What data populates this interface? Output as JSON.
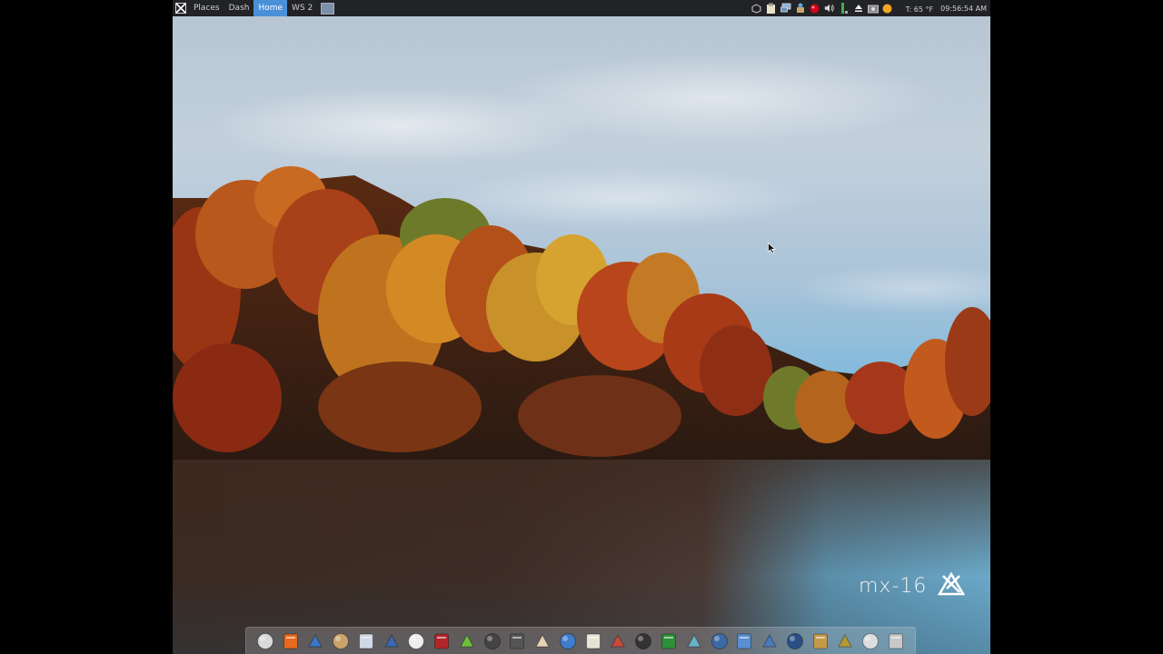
{
  "panel": {
    "tabs": [
      {
        "label": "Places"
      },
      {
        "label": "Dash"
      },
      {
        "label": "Home",
        "active": true
      },
      {
        "label": "WS 2"
      }
    ],
    "temperature": "T: 65 °F",
    "clock": "09:56:54 AM",
    "tray_icons": [
      "settings-cube-icon",
      "clipboard-icon",
      "network-icon",
      "package-updater-icon",
      "record-icon",
      "volume-icon",
      "battery-icon",
      "eject-icon",
      "screenshot-icon",
      "weather-sun-icon"
    ]
  },
  "desktop": {
    "brand": "mx-16",
    "brand_logo": "mx-logo-icon"
  },
  "dock": {
    "items": [
      {
        "name": "clock-app-icon",
        "color": "#d9d9d9"
      },
      {
        "name": "firefox-icon",
        "color": "#e66a1f"
      },
      {
        "name": "thunderbird-icon",
        "color": "#3b76c2"
      },
      {
        "name": "file-manager-icon",
        "color": "#c9a46a"
      },
      {
        "name": "text-editor-icon",
        "color": "#cfd8e6"
      },
      {
        "name": "calculator-icon",
        "color": "#3d66b0"
      },
      {
        "name": "dictionary-icon",
        "color": "#eeeeee"
      },
      {
        "name": "pdf-viewer-icon",
        "color": "#b2262a"
      },
      {
        "name": "leaf-app-icon",
        "color": "#6fbf3a"
      },
      {
        "name": "draw-tool-icon",
        "color": "#444444"
      },
      {
        "name": "tools-icon",
        "color": "#555555"
      },
      {
        "name": "document-icon",
        "color": "#e9d1b5"
      },
      {
        "name": "writer-icon",
        "color": "#3f7ccc"
      },
      {
        "name": "notes-icon",
        "color": "#e4e4d4"
      },
      {
        "name": "presentation-icon",
        "color": "#c94a3a"
      },
      {
        "name": "media-player-icon",
        "color": "#333333"
      },
      {
        "name": "globe-icon",
        "color": "#2f8f3a"
      },
      {
        "name": "music-icon",
        "color": "#6bb3c8"
      },
      {
        "name": "disk-icon",
        "color": "#3c6aa6"
      },
      {
        "name": "settings-icon",
        "color": "#5a8fd1"
      },
      {
        "name": "backup-icon",
        "color": "#4d79b8"
      },
      {
        "name": "camera-icon",
        "color": "#2c4f86"
      },
      {
        "name": "image-viewer-icon",
        "color": "#c49a49"
      },
      {
        "name": "add-panel-icon",
        "color": "#b59b36"
      },
      {
        "name": "search-icon",
        "color": "#dddddd"
      },
      {
        "name": "trash-icon",
        "color": "#c8c8c8"
      }
    ]
  }
}
